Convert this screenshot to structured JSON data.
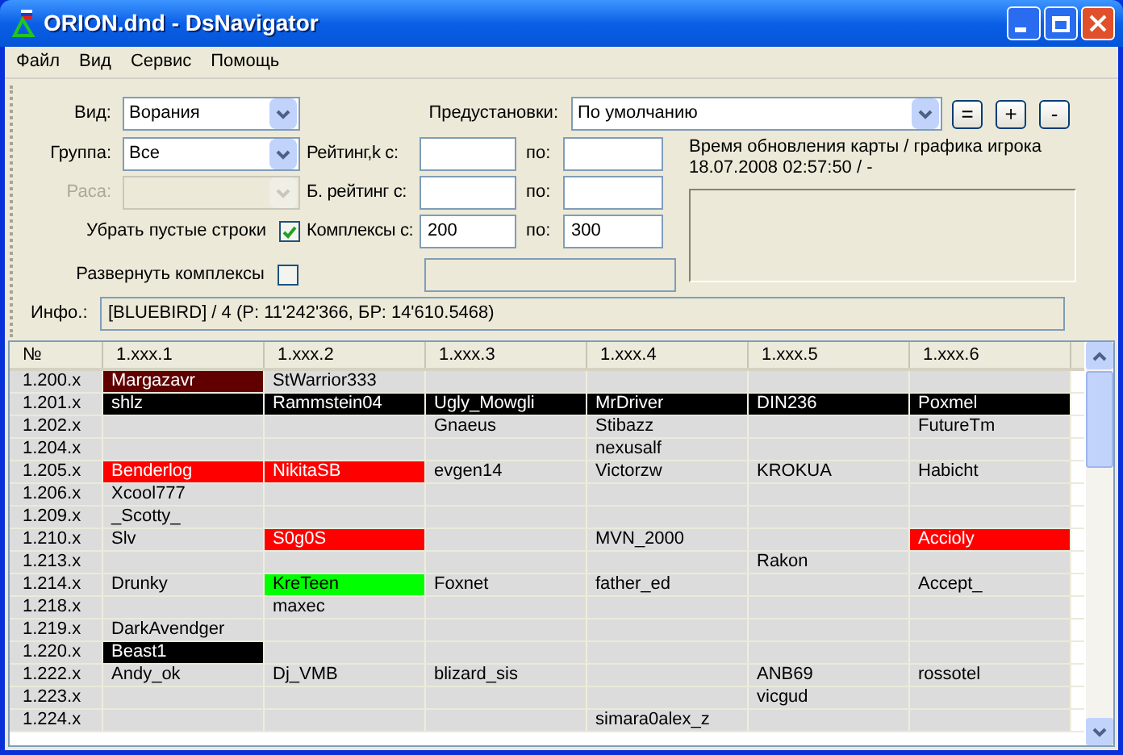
{
  "window": {
    "title": "ORION.dnd - DsNavigator"
  },
  "menu": [
    "Файл",
    "Вид",
    "Сервис",
    "Помощь"
  ],
  "form": {
    "view": {
      "label": "Вид:",
      "value": "Ворания"
    },
    "presets": {
      "label": "Предустановки:",
      "value": "По умолчанию"
    },
    "preset_buttons": [
      "=",
      "+",
      "-"
    ],
    "group": {
      "label": "Группа:",
      "value": "Все"
    },
    "race": {
      "label": "Раса:",
      "disabled": true
    },
    "hide_empty": {
      "label": "Убрать пустые строки",
      "checked": true
    },
    "expand": {
      "label": "Развернуть комплексы",
      "checked": false
    },
    "ranges": [
      {
        "label": "Рейтинг,k с:",
        "to_label": "по:"
      },
      {
        "label": "Б. рейтинг с:",
        "to_label": "по:"
      },
      {
        "label": "Комплексы с:",
        "from": "200",
        "to_label": "по:",
        "to": "300"
      }
    ],
    "update_time": {
      "label": "Время обновления карты / графика игрока",
      "value": "18.07.2008 02:57:50 / -"
    },
    "info": {
      "label": "Инфо.:",
      "value": "[BLUEBIRD] / 4 (P: 11'242'366, БР: 14'610.5468)"
    }
  },
  "table": {
    "columns": [
      "№",
      "1.xxx.1",
      "1.xxx.2",
      "1.xxx.3",
      "1.xxx.4",
      "1.xxx.5",
      "1.xxx.6"
    ],
    "rows": [
      {
        "cells": [
          {
            "text": "1.200.x"
          },
          {
            "text": "Margazavr",
            "color": "#600000"
          },
          {
            "text": "StWarrior333"
          },
          null,
          null,
          null,
          null
        ]
      },
      {
        "cells": [
          {
            "text": "1.201.x"
          },
          {
            "text": "shlz",
            "color": "#000000"
          },
          {
            "text": "Rammstein04",
            "color": "#000000"
          },
          {
            "text": "Ugly_Mowgli",
            "color": "#000000"
          },
          {
            "text": "MrDriver",
            "color": "#000000"
          },
          {
            "text": "DIN236",
            "color": "#000000"
          },
          {
            "text": "Poxmel",
            "color": "#000000"
          }
        ]
      },
      {
        "cells": [
          {
            "text": "1.202.x"
          },
          null,
          null,
          {
            "text": "Gnaeus"
          },
          {
            "text": "Stibazz"
          },
          null,
          {
            "text": "FutureTm"
          }
        ]
      },
      {
        "cells": [
          {
            "text": "1.204.x"
          },
          null,
          null,
          null,
          {
            "text": "nexusalf"
          },
          null,
          null
        ]
      },
      {
        "cells": [
          {
            "text": "1.205.x"
          },
          {
            "text": "Benderlog",
            "color": "#ff0000"
          },
          {
            "text": "NikitaSB",
            "color": "#ff0000"
          },
          {
            "text": "evgen14"
          },
          {
            "text": "Victorzw"
          },
          {
            "text": "KROKUA"
          },
          {
            "text": "Habicht"
          }
        ]
      },
      {
        "cells": [
          {
            "text": "1.206.x"
          },
          {
            "text": "Xcool777"
          },
          null,
          null,
          null,
          null,
          null
        ]
      },
      {
        "cells": [
          {
            "text": "1.209.x"
          },
          {
            "text": "_Scotty_"
          },
          null,
          null,
          null,
          null,
          null
        ]
      },
      {
        "cells": [
          {
            "text": "1.210.x"
          },
          {
            "text": "Slv"
          },
          {
            "text": "S0g0S",
            "color": "#ff0000"
          },
          null,
          {
            "text": "MVN_2000"
          },
          null,
          {
            "text": "Accioly",
            "color": "#ff0000"
          }
        ]
      },
      {
        "cells": [
          {
            "text": "1.213.x"
          },
          null,
          null,
          null,
          null,
          {
            "text": "Rakon"
          },
          null
        ]
      },
      {
        "cells": [
          {
            "text": "1.214.x"
          },
          {
            "text": "Drunky"
          },
          {
            "text": "KreTeen",
            "color": "#00ff00"
          },
          {
            "text": "Foxnet"
          },
          {
            "text": "father_ed"
          },
          null,
          {
            "text": "Accept_"
          }
        ]
      },
      {
        "cells": [
          {
            "text": "1.218.x"
          },
          null,
          {
            "text": "maxec"
          },
          null,
          null,
          null,
          null
        ]
      },
      {
        "cells": [
          {
            "text": "1.219.x"
          },
          {
            "text": "DarkAvendger"
          },
          null,
          null,
          null,
          null,
          null
        ]
      },
      {
        "cells": [
          {
            "text": "1.220.x"
          },
          {
            "text": "Beast1",
            "color": "#000000"
          },
          null,
          null,
          null,
          null,
          null
        ]
      },
      {
        "cells": [
          {
            "text": "1.222.x"
          },
          {
            "text": "Andy_ok"
          },
          {
            "text": "Dj_VMB"
          },
          {
            "text": "blizard_sis"
          },
          null,
          {
            "text": "ANB69"
          },
          {
            "text": "rossotel"
          }
        ]
      },
      {
        "cells": [
          {
            "text": "1.223.x"
          },
          null,
          null,
          null,
          null,
          {
            "text": "vicgud"
          },
          null
        ]
      },
      {
        "cells": [
          {
            "text": "1.224.x"
          },
          null,
          null,
          null,
          {
            "text": "simara0alex_z"
          },
          null,
          null
        ]
      }
    ]
  }
}
